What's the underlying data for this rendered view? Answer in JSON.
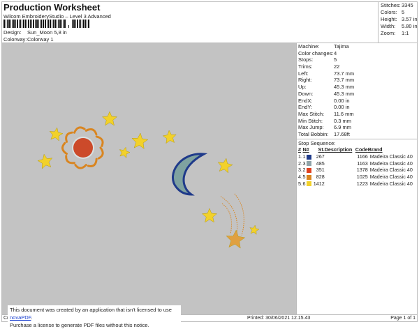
{
  "header": {
    "title": "Production Worksheet",
    "software": "Wilcom EmbroideryStudio – Level 3 Advanced",
    "design_label": "Design:",
    "design": "Sun_Moon 5,8 in",
    "colorway_label": "Colorway:",
    "colorway": "Colorway 1"
  },
  "stats": [
    {
      "k": "Stitches:",
      "v": "3345"
    },
    {
      "k": "Colors:",
      "v": "5"
    },
    {
      "k": "Height:",
      "v": "3.57 in"
    },
    {
      "k": "Width:",
      "v": "5.80 in"
    },
    {
      "k": "Zoom:",
      "v": "1:1"
    }
  ],
  "info": [
    {
      "k": "Machine:",
      "v": "Tajima"
    },
    {
      "k": "Color changes:",
      "v": "4"
    },
    {
      "k": "Stops:",
      "v": "5"
    },
    {
      "k": "Trims:",
      "v": "22"
    },
    {
      "k": "Left:",
      "v": "73.7 mm"
    },
    {
      "k": "Right:",
      "v": "73.7 mm"
    },
    {
      "k": "Up:",
      "v": "45.3 mm"
    },
    {
      "k": "Down:",
      "v": "45.3 mm"
    },
    {
      "k": "EndX:",
      "v": "0.00 in"
    },
    {
      "k": "EndY:",
      "v": "0.00 in"
    },
    {
      "k": "Max Stitch:",
      "v": "11.6 mm"
    },
    {
      "k": "Min Stitch:",
      "v": "0.3 mm"
    },
    {
      "k": "Max Jump:",
      "v": "6.9 mm"
    },
    {
      "k": "Total Bobbin:",
      "v": "17.68ft"
    }
  ],
  "sequence": {
    "title": "Stop Sequence:",
    "headers": [
      "#",
      "N#",
      "St.",
      "Description",
      "Code",
      "Brand"
    ],
    "rows": [
      {
        "n": "1.",
        "nn": "1",
        "color": "#1f3a8a",
        "st": "267",
        "desc": "",
        "code": "1166",
        "brand": "Madeira Classic 40"
      },
      {
        "n": "2.",
        "nn": "3",
        "color": "#8fa3a8",
        "st": "485",
        "desc": "",
        "code": "1163",
        "brand": "Madeira Classic 40"
      },
      {
        "n": "3.",
        "nn": "2",
        "color": "#e0401f",
        "st": "351",
        "desc": "",
        "code": "1378",
        "brand": "Madeira Classic 40"
      },
      {
        "n": "4.",
        "nn": "5",
        "color": "#d98520",
        "st": "828",
        "desc": "",
        "code": "1025",
        "brand": "Madeira Classic 40"
      },
      {
        "n": "5.",
        "nn": "6",
        "color": "#f2d12a",
        "st": "1412",
        "desc": "",
        "code": "1223",
        "brand": "Madeira Classic 40"
      }
    ]
  },
  "footer": {
    "cr": "Cr",
    "printed": "Printed: 30/06/2021 12.15.43",
    "page": "Page 1 of 1"
  },
  "notice": {
    "line1": "This document was created by an application that isn't licensed to use ",
    "link": "novaPDF",
    "period": ".",
    "line2": "Purchase a license to generate PDF files without this notice."
  }
}
